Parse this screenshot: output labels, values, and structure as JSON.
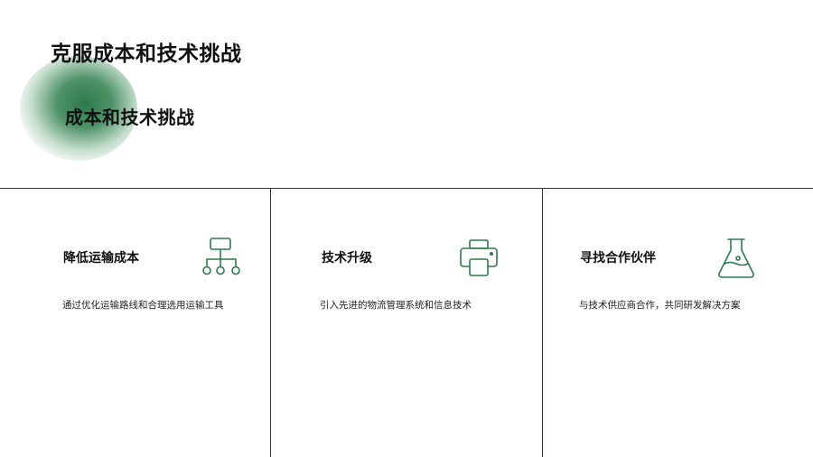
{
  "slide": {
    "title": "克服成本和技术挑战",
    "subtitle": "成本和技术挑战"
  },
  "cards": [
    {
      "title": "降低运输成本",
      "description": "通过优化运输路线和合理选用运输工具",
      "icon": "network-diagram-icon"
    },
    {
      "title": "技术升级",
      "description": "引入先进的物流管理系统和信息技术",
      "icon": "printer-icon"
    },
    {
      "title": "寻找合作伙伴",
      "description": "与技术供应商合作，共同研发解决方案",
      "icon": "flask-icon"
    }
  ],
  "colors": {
    "accent": "#2e7a4c",
    "text": "#111111",
    "divider": "#333333"
  }
}
